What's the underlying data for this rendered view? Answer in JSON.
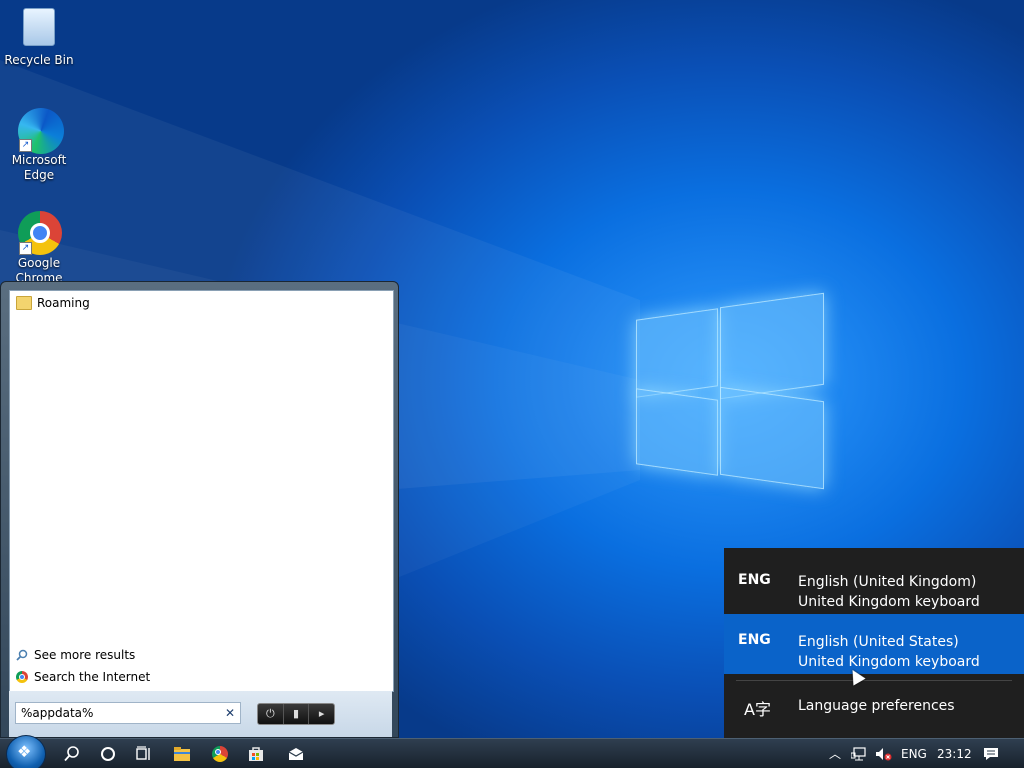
{
  "desktop": {
    "icons": [
      {
        "label": "Recycle Bin",
        "icon": "recycle-bin-icon"
      },
      {
        "label": "Microsoft Edge",
        "icon": "edge-icon"
      },
      {
        "label": "Google Chrome",
        "icon": "chrome-icon"
      }
    ]
  },
  "startmenu": {
    "results": [
      {
        "label": "Roaming",
        "icon": "folder-icon"
      }
    ],
    "see_more": "See more results",
    "search_internet": "Search the Internet",
    "search_value": "%appdata%",
    "clear_glyph": "✕"
  },
  "language_flyout": {
    "items": [
      {
        "code": "ENG",
        "line1": "English (United Kingdom)",
        "line2": "United Kingdom keyboard",
        "selected": false
      },
      {
        "code": "ENG",
        "line1": "English (United States)",
        "line2": "United Kingdom keyboard",
        "selected": true
      }
    ],
    "preferences": "Language preferences"
  },
  "taskbar": {
    "tray": {
      "language": "ENG",
      "time": "23:12"
    }
  },
  "colors": {
    "flyout_bg": "#1f1f1f",
    "flyout_selected": "#0a63c9",
    "taskbar": "#18222c"
  }
}
